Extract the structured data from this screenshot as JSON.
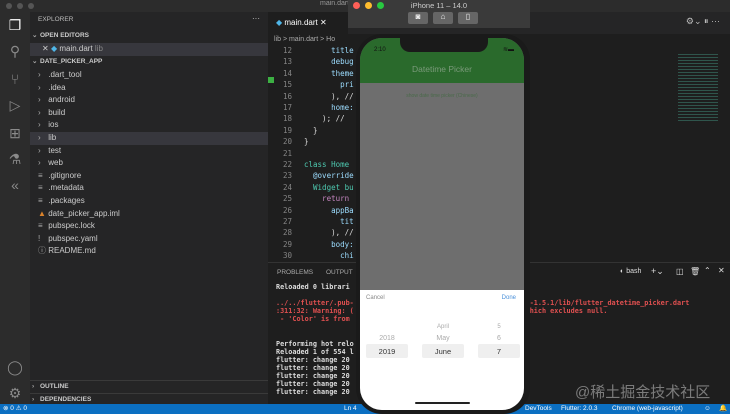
{
  "window": {
    "title": "main.dart"
  },
  "sidebar": {
    "title": "EXPLORER",
    "more": "···",
    "open_editors": "OPEN EDITORS",
    "open_file": "main.dart",
    "open_file_dir": "lib",
    "project": "DATE_PICKER_APP",
    "items": [
      {
        "label": ".dart_tool",
        "type": "folder"
      },
      {
        "label": ".idea",
        "type": "folder"
      },
      {
        "label": "android",
        "type": "folder"
      },
      {
        "label": "build",
        "type": "folder"
      },
      {
        "label": "ios",
        "type": "folder"
      },
      {
        "label": "lib",
        "type": "folder"
      },
      {
        "label": "test",
        "type": "folder"
      },
      {
        "label": "web",
        "type": "folder"
      },
      {
        "label": ".gitignore",
        "type": "file"
      },
      {
        "label": ".metadata",
        "type": "file"
      },
      {
        "label": ".packages",
        "type": "file"
      },
      {
        "label": "date_picker_app.iml",
        "type": "file"
      },
      {
        "label": "pubspec.lock",
        "type": "file"
      },
      {
        "label": "pubspec.yaml",
        "type": "file"
      },
      {
        "label": "README.md",
        "type": "file"
      }
    ],
    "outline": "OUTLINE",
    "dependencies": "DEPENDENCIES"
  },
  "editor": {
    "tab": "main.dart",
    "breadcrumb": "lib > main.dart > Ho",
    "lines": [
      {
        "n": "12",
        "t": "      title"
      },
      {
        "n": "13",
        "t": "      debug"
      },
      {
        "n": "14",
        "t": "      theme"
      },
      {
        "n": "15",
        "t": "        pri"
      },
      {
        "n": "16",
        "t": "      ), //"
      },
      {
        "n": "17",
        "t": "      home:"
      },
      {
        "n": "18",
        "t": "    ); //"
      },
      {
        "n": "19",
        "t": "  }"
      },
      {
        "n": "20",
        "t": "}"
      },
      {
        "n": "21",
        "t": ""
      },
      {
        "n": "22",
        "t": "class Home"
      },
      {
        "n": "23",
        "t": "  @override"
      },
      {
        "n": "24",
        "t": "  Widget bu"
      },
      {
        "n": "25",
        "t": "    return"
      },
      {
        "n": "26",
        "t": "      appBa"
      },
      {
        "n": "27",
        "t": "        tit"
      },
      {
        "n": "28",
        "t": "      ), //"
      },
      {
        "n": "29",
        "t": "      body:"
      },
      {
        "n": "30",
        "t": "        chi"
      }
    ]
  },
  "panel": {
    "tabs": [
      "PROBLEMS",
      "OUTPUT"
    ],
    "shell": "bash",
    "lines": [
      {
        "t": "Reloaded 0 librari",
        "c": "#ddd"
      },
      {
        "t": "",
        "c": "#ddd"
      },
      {
        "t": "../../flutter/.pub-                                    _picker-1.5.1/lib/flutter_datetime_picker.dart",
        "c": "#e05050"
      },
      {
        "t": ":311:32: Warning: (                                   Color' which excludes null.",
        "c": "#e05050"
      },
      {
        "t": " - 'Color' is from",
        "c": "#e05050"
      },
      {
        "t": "",
        "c": "#ddd"
      },
      {
        "t": "",
        "c": "#ddd"
      },
      {
        "t": "Performing hot relo",
        "c": "#ddd"
      },
      {
        "t": "Reloaded 1 of 554 l",
        "c": "#ddd"
      },
      {
        "t": "flutter: change 20",
        "c": "#ddd"
      },
      {
        "t": "flutter: change 20",
        "c": "#ddd"
      },
      {
        "t": "flutter: change 20",
        "c": "#ddd"
      },
      {
        "t": "flutter: change 20",
        "c": "#ddd"
      },
      {
        "t": "flutter: change 20",
        "c": "#ddd"
      }
    ]
  },
  "status": {
    "errors": "0",
    "warnings": "0",
    "position": "Ln 4",
    "devtools": "DevTools",
    "flutter": "Flutter: 2.0.3",
    "device": "Chrome (web-javascript)"
  },
  "simulator": {
    "title": "iPhone 11 – 14.0",
    "time": "2:10",
    "app_title": "Datetime Picker",
    "button": "show date time picker (Chinese)",
    "cancel": "Cancel",
    "done": "Done",
    "years": [
      "2018",
      "2019"
    ],
    "months": [
      "April",
      "May",
      "June"
    ],
    "days": [
      "5",
      "6",
      "7"
    ]
  },
  "watermark": "@稀土掘金技术社区",
  "colors": {
    "status_bar": "#0b6fc2",
    "app_bar": "#2a6a2c",
    "done": "#4a90d9"
  }
}
